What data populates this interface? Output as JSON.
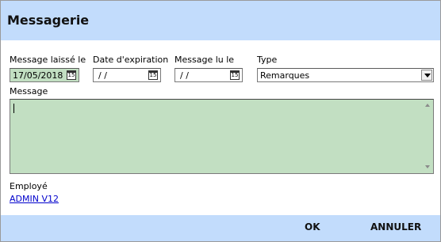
{
  "window": {
    "title": "Messagerie"
  },
  "form": {
    "message_left_label": "Message laissé le",
    "message_left_value": "17/05/2018",
    "expiration_label": "Date d'expiration",
    "expiration_value": "/ /",
    "read_label": "Message lu le",
    "read_value": "/ /",
    "type_label": "Type",
    "type_value": "Remarques",
    "message_label": "Message",
    "message_value": "",
    "employee_label": "Employé",
    "employee_value": "ADMIN V12"
  },
  "calendar_icon_glyph": "15",
  "buttons": {
    "ok": "OK",
    "cancel": "ANNULER"
  },
  "colors": {
    "header_bg": "#c2dcfc",
    "field_green": "#c2dfc2",
    "link": "#0000cc"
  },
  "icons": [
    "calendar-icon",
    "dropdown-arrow-icon",
    "scroll-up-icon",
    "scroll-down-icon"
  ]
}
